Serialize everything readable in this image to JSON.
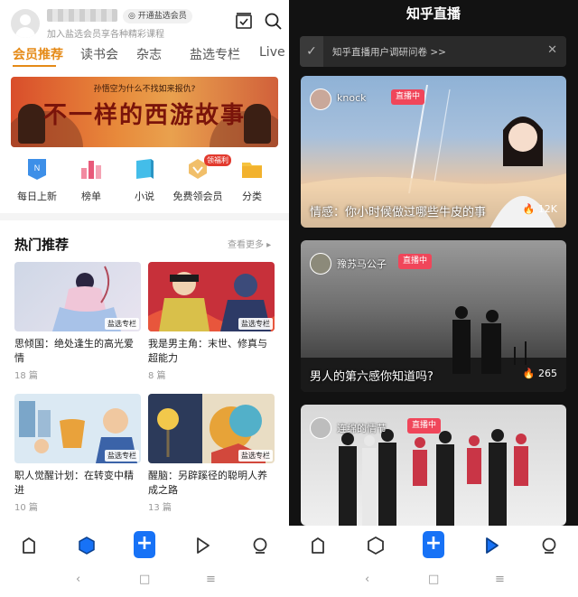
{
  "left": {
    "header": {
      "vip_chip": "开通盐选会员",
      "subtitle": "加入盐选会员享各种精彩课程"
    },
    "tabs": [
      "会员推荐",
      "读书会",
      "杂志",
      "盐选专栏",
      "Live"
    ],
    "banner": {
      "top_text": "孙悟空为什么不找如来报仇?",
      "title": "不一样的西游故事"
    },
    "quick_icons": [
      {
        "label": "每日上新",
        "icon": "daily-new-icon",
        "color": "#2f8ae8"
      },
      {
        "label": "榜单",
        "icon": "ranking-icon",
        "color": "#e85a7a"
      },
      {
        "label": "小说",
        "icon": "novel-icon",
        "color": "#2fb0e8"
      },
      {
        "label": "免费领会员",
        "icon": "free-vip-icon",
        "color": "#e9a23b",
        "badge": "领福利"
      },
      {
        "label": "分类",
        "icon": "category-icon",
        "color": "#f2b22e"
      }
    ],
    "section": {
      "title": "热门推荐",
      "more": "查看更多 ▸"
    },
    "cards": [
      {
        "title": "思倾国：绝处逢生的高光爱情",
        "count": "18 篇",
        "tag": "盐选专栏"
      },
      {
        "title": "我是男主角：末世、修真与超能力",
        "count": "8 篇",
        "tag": "盐选专栏"
      },
      {
        "title": "职人觉醒计划：在转变中精进",
        "count": "10 篇",
        "tag": "盐选专栏"
      },
      {
        "title": "醒脑：另辟蹊径的聪明人养成之路",
        "count": "13 篇",
        "tag": "盐选专栏"
      }
    ],
    "tabbar": {
      "plus": "+"
    },
    "sysnav": {
      "back": "‹",
      "home": "□",
      "menu": "≡"
    }
  },
  "right": {
    "title": "知乎直播",
    "survey": {
      "text": "知乎直播用户调研问卷 >>",
      "check": "✓",
      "close": "✕"
    },
    "lives": [
      {
        "host": "knock",
        "badge": "直播中",
        "title": "情感：你小时候做过哪些牛皮的事",
        "heat": "12K"
      },
      {
        "host": "豫苏马公子",
        "badge": "直播中",
        "title": "男人的第六感你知道吗?",
        "heat": "265"
      },
      {
        "host": "连绵的情节",
        "badge": "直播中",
        "title": "",
        "heat": ""
      }
    ],
    "tabbar": {
      "plus": "+"
    },
    "sysnav": {
      "back": "‹",
      "home": "□",
      "menu": "≡"
    }
  },
  "colors": {
    "accent": "#e58a17",
    "zhihu_blue": "#1772f6",
    "live_red": "#f0465a"
  }
}
